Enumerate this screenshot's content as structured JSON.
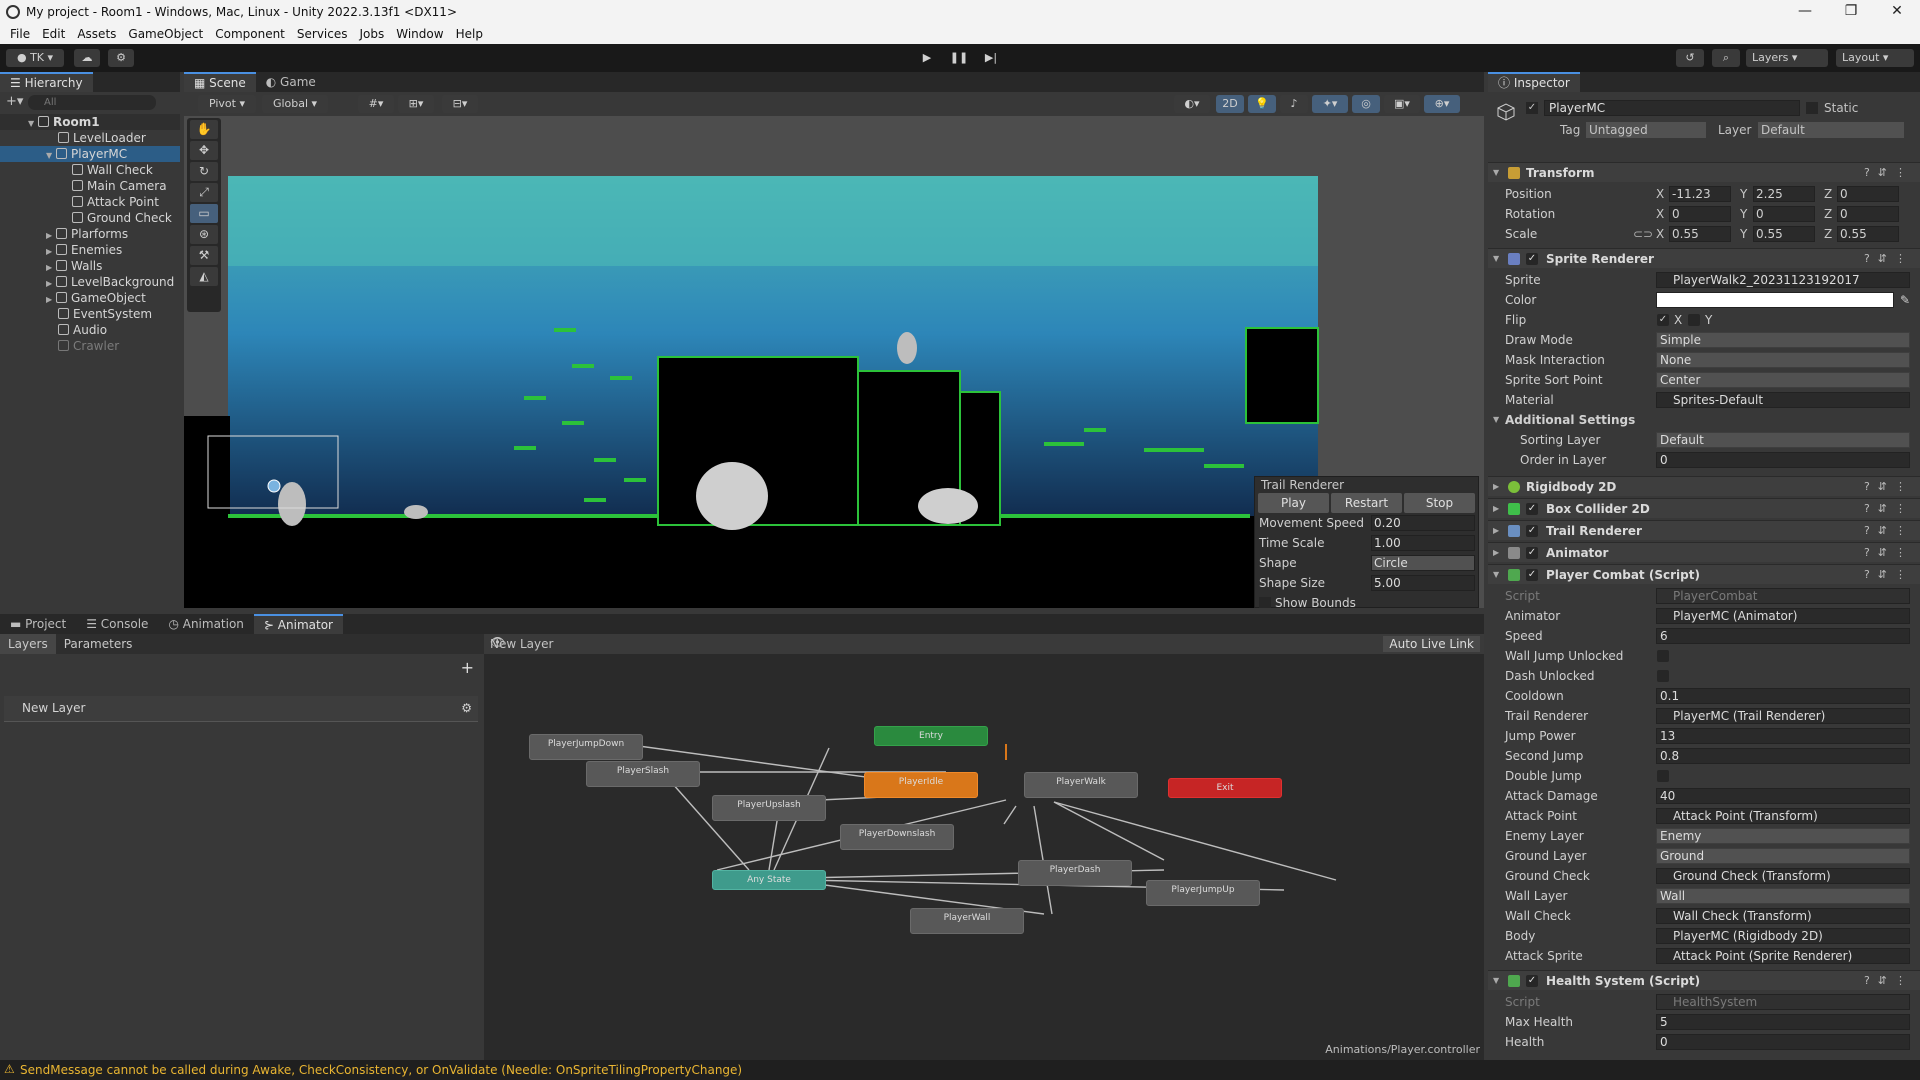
{
  "window": {
    "title": "My project - Room1 - Windows, Mac, Linux - Unity 2022.3.13f1 <DX11>",
    "minimize": "—",
    "maximize": "❐",
    "close": "✕"
  },
  "menu": [
    "File",
    "Edit",
    "Assets",
    "GameObject",
    "Component",
    "Services",
    "Jobs",
    "Window",
    "Help"
  ],
  "toolbar": {
    "account": "TK",
    "layers": "Layers",
    "layout": "Layout"
  },
  "hierarchy": {
    "tab": "Hierarchy",
    "search_placeholder": "All",
    "items": [
      "Room1",
      "LevelLoader",
      "PlayerMC",
      "Wall Check",
      "Main Camera",
      "Attack Point",
      "Ground Check",
      "Plarforms",
      "Enemies",
      "Walls",
      "LevelBackground",
      "GameObject",
      "EventSystem",
      "Audio",
      "Crawler"
    ]
  },
  "scene": {
    "tabs": [
      "Scene",
      "Game"
    ],
    "pivot": "Pivot",
    "global": "Global",
    "mode_2d": "2D",
    "trail": {
      "title": "Trail Renderer",
      "buttons": [
        "Play",
        "Restart",
        "Stop"
      ],
      "movement_speed_label": "Movement Speed",
      "movement_speed": "0.20",
      "time_scale_label": "Time Scale",
      "time_scale": "1.00",
      "shape_label": "Shape",
      "shape": "Circle",
      "shape_size_label": "Shape Size",
      "shape_size": "5.00",
      "show_bounds": "Show Bounds"
    }
  },
  "bottom": {
    "tabs": [
      "Project",
      "Console",
      "Animation",
      "Animator"
    ],
    "layers_tab": "Layers",
    "params_tab": "Parameters",
    "layer_name": "New Layer",
    "breadcrumb": "New Layer",
    "auto_live_link": "Auto Live Link",
    "controller_path": "Animations/Player.controller",
    "states": [
      "PlayerJumpDown",
      "PlayerSlash",
      "PlayerUpslash",
      "Entry",
      "PlayerIdle",
      "PlayerWalk",
      "Exit",
      "PlayerDownslash",
      "Any State",
      "PlayerDash",
      "PlayerJumpUp",
      "PlayerWall"
    ],
    "colors": {
      "entry": "#2a8a3e",
      "idle": "#d9771a",
      "exit": "#c62525",
      "anystate": "#3f9b8c",
      "default": "#585858"
    }
  },
  "inspector": {
    "tab": "Inspector",
    "object_name": "PlayerMC",
    "static_label": "Static",
    "tag_label": "Tag",
    "tag": "Untagged",
    "layer_label": "Layer",
    "layer": "Default",
    "transform": {
      "title": "Transform",
      "position_label": "Position",
      "px": "-11.23",
      "py": "2.25",
      "pz": "0",
      "rotation_label": "Rotation",
      "rx": "0",
      "ry": "0",
      "rz": "0",
      "scale_label": "Scale",
      "sx": "0.55",
      "sy": "0.55",
      "sz": "0.55"
    },
    "sprite_renderer": {
      "title": "Sprite Renderer",
      "sprite_label": "Sprite",
      "sprite": "PlayerWalk2_20231123192017",
      "color_label": "Color",
      "flip_label": "Flip",
      "flip_x": "X",
      "flip_y": "Y",
      "draw_mode_label": "Draw Mode",
      "draw_mode": "Simple",
      "mask_label": "Mask Interaction",
      "mask": "None",
      "sort_point_label": "Sprite Sort Point",
      "sort_point": "Center",
      "material_label": "Material",
      "material": "Sprites-Default",
      "additional": "Additional Settings",
      "sorting_layer_label": "Sorting Layer",
      "sorting_layer": "Default",
      "order_label": "Order in Layer",
      "order": "0"
    },
    "components": [
      "Rigidbody 2D",
      "Box Collider 2D",
      "Trail Renderer",
      "Animator"
    ],
    "player_combat": {
      "title": "Player Combat (Script)",
      "rows": [
        {
          "label": "Script",
          "value": "PlayerCombat",
          "kind": "obj"
        },
        {
          "label": "Animator",
          "value": "PlayerMC (Animator)",
          "kind": "obj"
        },
        {
          "label": "Speed",
          "value": "6",
          "kind": "num"
        },
        {
          "label": "Wall Jump Unlocked",
          "value": "",
          "kind": "check"
        },
        {
          "label": "Dash Unlocked",
          "value": "",
          "kind": "check"
        },
        {
          "label": "Cooldown",
          "value": "0.1",
          "kind": "num"
        },
        {
          "label": "Trail Renderer",
          "value": "PlayerMC (Trail Renderer)",
          "kind": "obj"
        },
        {
          "label": "Jump Power",
          "value": "13",
          "kind": "num"
        },
        {
          "label": "Second Jump",
          "value": "0.8",
          "kind": "num"
        },
        {
          "label": "Double Jump",
          "value": "",
          "kind": "check"
        },
        {
          "label": "Attack Damage",
          "value": "40",
          "kind": "num"
        },
        {
          "label": "Attack Point",
          "value": "Attack Point (Transform)",
          "kind": "obj"
        },
        {
          "label": "Enemy Layer",
          "value": "Enemy",
          "kind": "drop"
        },
        {
          "label": "Ground Layer",
          "value": "Ground",
          "kind": "drop"
        },
        {
          "label": "Ground Check",
          "value": "Ground Check (Transform)",
          "kind": "obj"
        },
        {
          "label": "Wall Layer",
          "value": "Wall",
          "kind": "drop"
        },
        {
          "label": "Wall Check",
          "value": "Wall Check (Transform)",
          "kind": "obj"
        },
        {
          "label": "Body",
          "value": "PlayerMC (Rigidbody 2D)",
          "kind": "obj"
        },
        {
          "label": "Attack Sprite",
          "value": "Attack Point (Sprite Renderer)",
          "kind": "obj"
        }
      ]
    },
    "health_system": {
      "title": "Health System (Script)",
      "script_label": "Script",
      "script": "HealthSystem",
      "max_health_label": "Max Health",
      "max_health": "5",
      "health_label": "Health",
      "health": "0"
    }
  },
  "status": {
    "message": "SendMessage cannot be called during Awake, CheckConsistency, or OnValidate (Needle: OnSpriteTilingPropertyChange)"
  }
}
